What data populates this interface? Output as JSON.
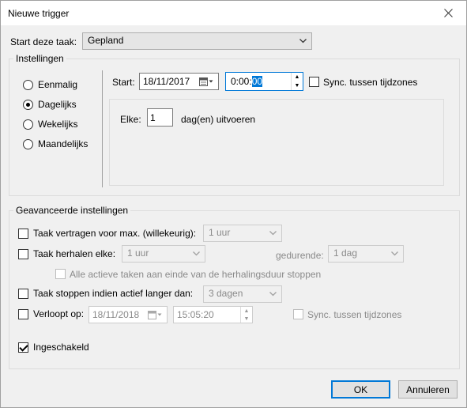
{
  "window": {
    "title": "Nieuwe trigger",
    "close_icon": "close-icon"
  },
  "task": {
    "label": "Start deze taak:",
    "value": "Gepland"
  },
  "settings": {
    "group_label": "Instellingen",
    "radios": [
      {
        "label": "Eenmalig",
        "checked": false
      },
      {
        "label": "Dagelijks",
        "checked": true
      },
      {
        "label": "Wekelijks",
        "checked": false
      },
      {
        "label": "Maandelijks",
        "checked": false
      }
    ],
    "start_label": "Start:",
    "start_date": "18/11/2017",
    "start_time_prefix": "0:00:",
    "start_time_selected": "00",
    "sync_label": "Sync. tussen tijdzones",
    "every_label": "Elke:",
    "every_value": "1",
    "every_suffix": "dag(en) uitvoeren"
  },
  "advanced": {
    "group_label": "Geavanceerde instellingen",
    "delay": {
      "label": "Taak vertragen voor max. (willekeurig):",
      "value": "1 uur"
    },
    "repeat": {
      "label": "Taak herhalen elke:",
      "value": "1 uur",
      "duration_label": "gedurende:",
      "duration_value": "1 dag"
    },
    "stop_all_label": "Alle actieve taken aan einde van de herhalingsduur stoppen",
    "stop": {
      "label": "Taak stoppen indien actief langer dan:",
      "value": "3 dagen"
    },
    "expire": {
      "label": "Verloopt op:",
      "date": "18/11/2018",
      "time": "15:05:20",
      "sync_label": "Sync. tussen tijdzones"
    },
    "enabled": {
      "label": "Ingeschakeld",
      "checked": true
    }
  },
  "buttons": {
    "ok": "OK",
    "cancel": "Annuleren"
  }
}
